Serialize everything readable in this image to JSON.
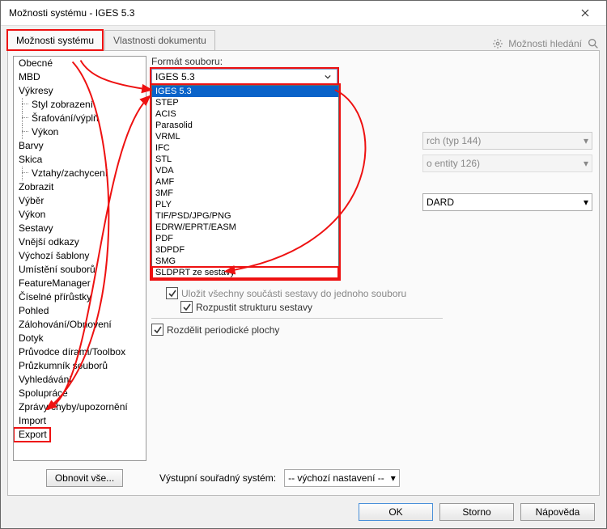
{
  "window": {
    "title": "Možnosti systému - IGES 5.3"
  },
  "toolbar": {
    "tab_system": "Možnosti systému",
    "tab_document": "Vlastnosti dokumentu",
    "search_placeholder": "Možnosti hledání"
  },
  "sidebar": {
    "items": [
      "Obecné",
      "MBD",
      "Výkresy",
      "Styl zobrazení",
      "Šrafování/výplň",
      "Výkon",
      "Barvy",
      "Skica",
      "Vztahy/zachycení",
      "Zobrazit",
      "Výběr",
      "Výkon",
      "Sestavy",
      "Vnější odkazy",
      "Výchozí šablony",
      "Umístění souborů",
      "FeatureManager",
      "Číselné přírůstky",
      "Pohled",
      "Zálohování/Obnovení",
      "Dotyk",
      "Průvodce dírami/Toolbox",
      "Průzkumník souborů",
      "Vyhledávání",
      "Spolupráce",
      "Zprávy/chyby/upozornění",
      "Import",
      "Export"
    ],
    "sub_idx": [
      3,
      4,
      5,
      8
    ],
    "restore_btn": "Obnovit vše..."
  },
  "main": {
    "format_label": "Formát souboru:",
    "selected_format": "IGES 5.3",
    "options": [
      "IGES 5.3",
      "STEP",
      "ACIS",
      "Parasolid",
      "VRML",
      "IFC",
      "STL",
      "VDA",
      "AMF",
      "3MF",
      "PLY",
      "TIF/PSD/JPG/PNG",
      "EDRW/EPRT/EASM",
      "PDF",
      "3DPDF",
      "SMG",
      "SLDPRT ze sestavy"
    ],
    "right_ro1": "rch (typ 144)",
    "right_ro2": "o entity 126)",
    "right_std": "DARD",
    "chk_save_all": "Uložit všechny součásti sestavy do jednoho souboru",
    "chk_dissolve": "Rozpustit strukturu sestavy",
    "chk_split": "Rozdělit periodické plochy",
    "coord_label": "Výstupní souřadný systém:",
    "coord_value": "-- výchozí nastavení --"
  },
  "footer": {
    "ok": "OK",
    "cancel": "Storno",
    "help": "Nápověda"
  }
}
